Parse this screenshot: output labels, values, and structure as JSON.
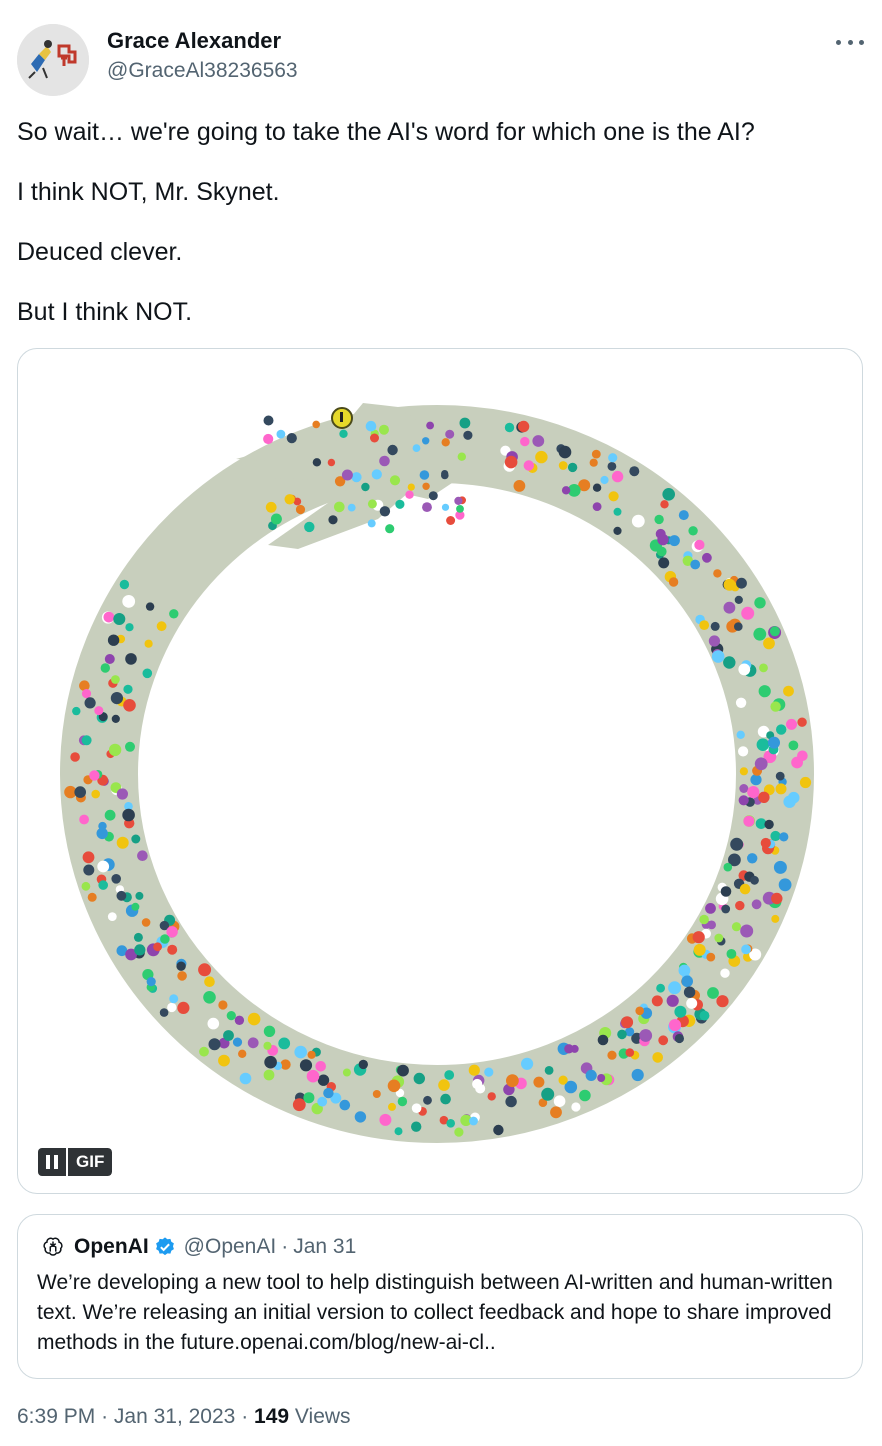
{
  "author": {
    "name": "Grace Alexander",
    "handle": "@GraceAl38236563",
    "avatar_icon": "avatar-image"
  },
  "more_icon": "more-dots-icon",
  "post": {
    "paragraphs": [
      "So wait… we're going to take the AI's word for which one is the AI?",
      "I think NOT, Mr. Skynet.",
      "Deuced clever.",
      "But I think NOT."
    ]
  },
  "media": {
    "type": "gif",
    "image": "ouroboros-snake-with-colorful-dots",
    "gif_badge": "GIF",
    "pause_icon": "pause-icon",
    "colors": {
      "snake_body": "#c8cfbd",
      "eye": "#e6d92a"
    }
  },
  "quoted": {
    "logo_icon": "openai-logo-icon",
    "name": "OpenAI",
    "verified_icon": "verified-badge-icon",
    "handle": "@OpenAI",
    "separator": "·",
    "date": "Jan 31",
    "text": "We’re developing a new tool to help distinguish between AI-written and human-written text. We’re releasing an initial version to collect feedback and hope to share improved methods in the future.openai.com/blog/new-ai-cl.."
  },
  "footer": {
    "time": "6:39 PM",
    "sep1": "·",
    "date": "Jan 31, 2023",
    "sep2": "·",
    "views_count": "149",
    "views_label": "Views"
  },
  "colors": {
    "text": "#0f1419",
    "secondary": "#536471",
    "border": "#cfd9de",
    "verified": "#1d9bf0"
  }
}
